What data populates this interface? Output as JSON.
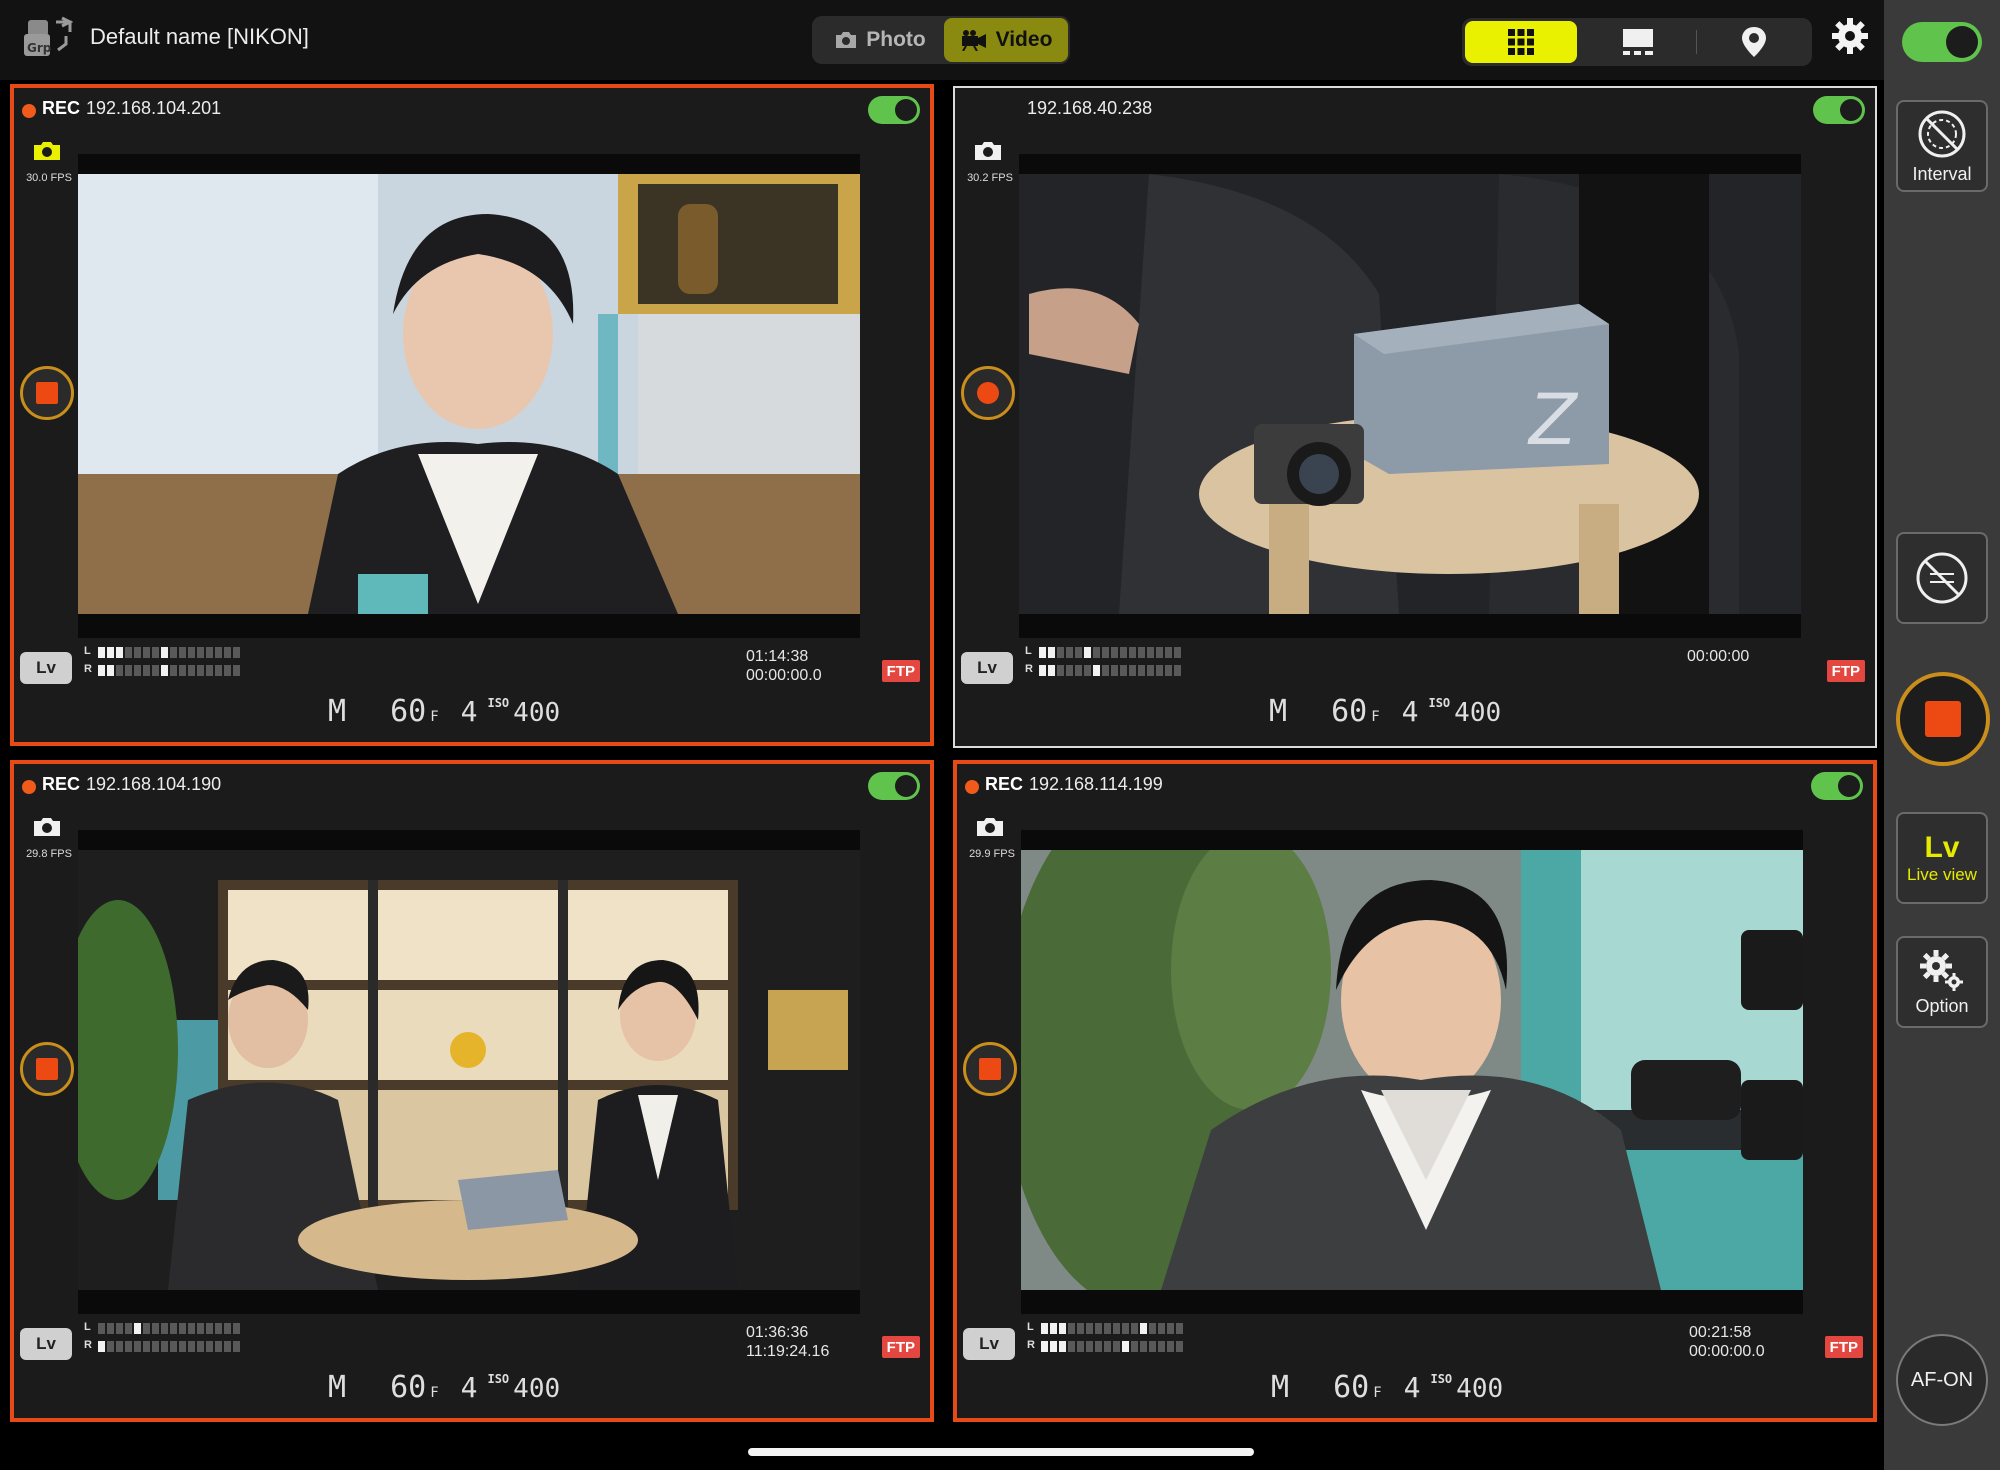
{
  "header": {
    "device_name": "Default name [NIKON]",
    "modes": {
      "photo": "Photo",
      "video": "Video",
      "active": "video"
    },
    "view_options": [
      "grid-view-icon",
      "single-view-icon",
      "location-pin-icon"
    ],
    "active_view": "grid"
  },
  "sidebar": {
    "master_toggle": "on",
    "interval_label": "Interval",
    "liveview_big": "Lv",
    "liveview_label": "Live view",
    "option_label": "Option",
    "afon_label": "AF-ON"
  },
  "colors": {
    "recording_border": "#e54a17",
    "active_yellow": "#eaf100",
    "toggle_green": "#5fc34c",
    "ftp_red": "#e4473f"
  },
  "cameras": [
    {
      "recording": true,
      "rec_label": "REC",
      "ip": "192.168.104.201",
      "fps": "30.0 FPS",
      "enabled": true,
      "meter_left": [
        1,
        1,
        1,
        0,
        0,
        0,
        0,
        1,
        0,
        0,
        0,
        0,
        0,
        0,
        0,
        0
      ],
      "meter_right": [
        1,
        1,
        0,
        0,
        0,
        0,
        0,
        1,
        0,
        0,
        0,
        0,
        0,
        0,
        0,
        0
      ],
      "timecode_a": "01:14:38",
      "timecode_b": "00:00:00.0",
      "ftp": "FTP",
      "lv": "Lv",
      "exposure": {
        "mode": "M",
        "shutter": "60",
        "fl": "F",
        "aperture": "4",
        "iso_label": "ISO",
        "iso": "400"
      }
    },
    {
      "recording": false,
      "rec_label": "",
      "ip": "192.168.40.238",
      "fps": "30.2 FPS",
      "enabled": true,
      "meter_left": [
        1,
        1,
        0,
        0,
        0,
        1,
        0,
        0,
        0,
        0,
        0,
        0,
        0,
        0,
        0,
        0
      ],
      "meter_right": [
        1,
        1,
        0,
        0,
        0,
        0,
        1,
        0,
        0,
        0,
        0,
        0,
        0,
        0,
        0,
        0
      ],
      "timecode_a": "00:00:00",
      "timecode_b": "",
      "ftp": "FTP",
      "lv": "Lv",
      "exposure": {
        "mode": "M",
        "shutter": "60",
        "fl": "F",
        "aperture": "4",
        "iso_label": "ISO",
        "iso": "400"
      }
    },
    {
      "recording": true,
      "rec_label": "REC",
      "ip": "192.168.104.190",
      "fps": "29.8 FPS",
      "enabled": true,
      "meter_left": [
        0,
        0,
        0,
        0,
        1,
        0,
        0,
        0,
        0,
        0,
        0,
        0,
        0,
        0,
        0,
        0
      ],
      "meter_right": [
        1,
        0,
        0,
        0,
        0,
        0,
        0,
        0,
        0,
        0,
        0,
        0,
        0,
        0,
        0,
        0
      ],
      "timecode_a": "01:36:36",
      "timecode_b": "11:19:24.16",
      "ftp": "FTP",
      "lv": "Lv",
      "exposure": {
        "mode": "M",
        "shutter": "60",
        "fl": "F",
        "aperture": "4",
        "iso_label": "ISO",
        "iso": "400"
      }
    },
    {
      "recording": true,
      "rec_label": "REC",
      "ip": "192.168.114.199",
      "fps": "29.9 FPS",
      "enabled": true,
      "meter_left": [
        1,
        1,
        1,
        0,
        0,
        0,
        0,
        0,
        0,
        0,
        0,
        1,
        0,
        0,
        0,
        0
      ],
      "meter_right": [
        1,
        1,
        1,
        0,
        0,
        0,
        0,
        0,
        0,
        1,
        0,
        0,
        0,
        0,
        0,
        0
      ],
      "timecode_a": "00:21:58",
      "timecode_b": "00:00:00.0",
      "ftp": "FTP",
      "lv": "Lv",
      "exposure": {
        "mode": "M",
        "shutter": "60",
        "fl": "F",
        "aperture": "4",
        "iso_label": "ISO",
        "iso": "400"
      }
    }
  ]
}
